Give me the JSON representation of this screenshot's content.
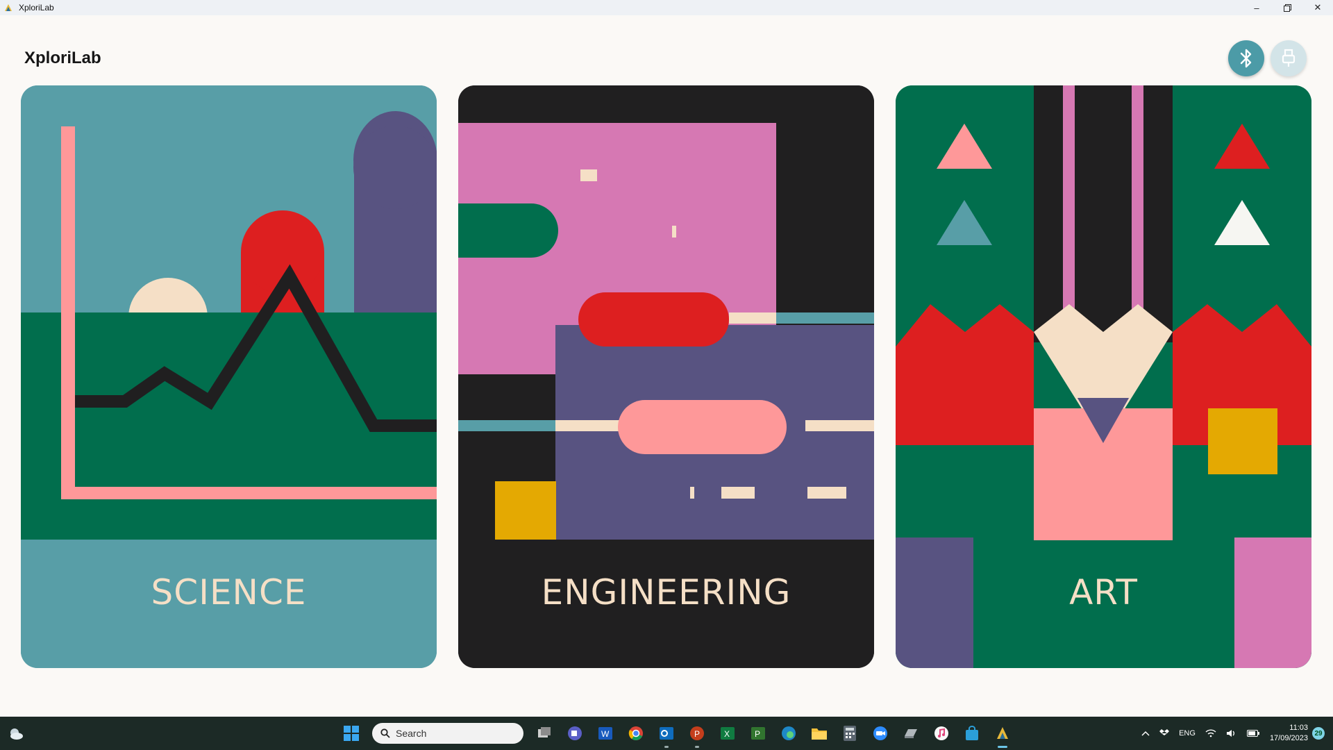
{
  "window": {
    "title": "XploriLab",
    "minimize_icon": "minimize-icon",
    "restore_icon": "restore-icon",
    "close_icon": "close-icon"
  },
  "header": {
    "app_name": "XploriLab",
    "bluetooth_icon": "bluetooth-icon",
    "usb_icon": "usb-plug-icon"
  },
  "cards": [
    {
      "label": "SCIENCE"
    },
    {
      "label": "ENGINEERING"
    },
    {
      "label": "ART"
    }
  ],
  "colors": {
    "teal": "#589ea7",
    "dark_green": "#016e4d",
    "pink": "#fe9899",
    "red": "#dd1f20",
    "purple": "#585381",
    "cream": "#f5dfc6",
    "magenta": "#d678b3",
    "yellow": "#e4a902",
    "black": "#201f20"
  },
  "taskbar": {
    "search_placeholder": "Search",
    "apps": [
      "start-icon",
      "task-view-icon",
      "teams-icon",
      "word-icon",
      "chrome-icon",
      "outlook-icon",
      "powerpoint-icon",
      "excel-icon",
      "project-icon",
      "edge-icon",
      "file-explorer-icon",
      "calculator-icon",
      "zoom-icon",
      "drive-icon",
      "itunes-icon",
      "store-icon",
      "xplorilab-icon"
    ],
    "tray": {
      "language": "ENG",
      "time": "11:03",
      "date": "17/09/2023",
      "notifications": "29"
    }
  }
}
